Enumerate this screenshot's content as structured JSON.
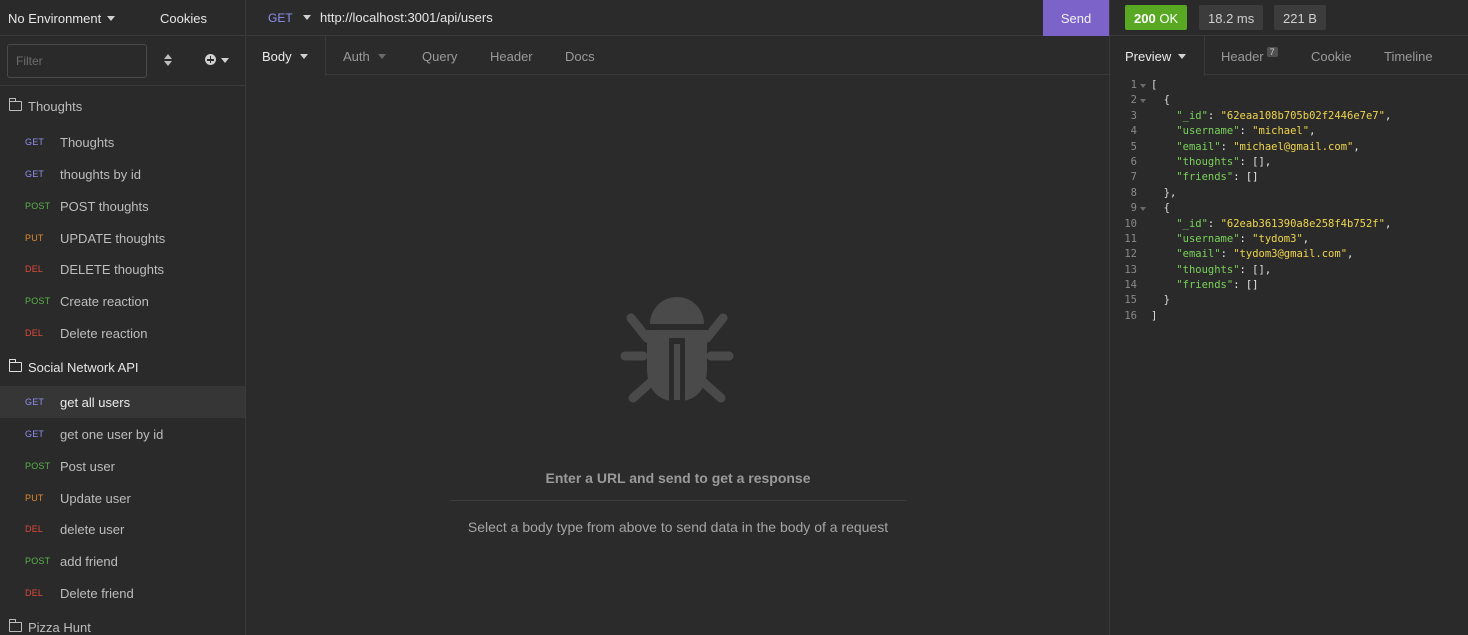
{
  "sidebar": {
    "environment": "No Environment",
    "cookies_label": "Cookies",
    "filter_placeholder": "Filter",
    "folders": [
      {
        "name": "Thoughts"
      },
      {
        "name": "Social Network API"
      },
      {
        "name": "Pizza Hunt"
      }
    ],
    "requests": [
      {
        "method": "GET",
        "label": "Thoughts"
      },
      {
        "method": "GET",
        "label": "thoughts by id"
      },
      {
        "method": "POST",
        "label": "POST thoughts"
      },
      {
        "method": "PUT",
        "label": "UPDATE thoughts"
      },
      {
        "method": "DEL",
        "label": "DELETE thoughts"
      },
      {
        "method": "POST",
        "label": "Create reaction"
      },
      {
        "method": "DEL",
        "label": "Delete reaction"
      },
      {
        "method": "GET",
        "label": "get all users"
      },
      {
        "method": "GET",
        "label": "get one user by id"
      },
      {
        "method": "POST",
        "label": "Post user"
      },
      {
        "method": "PUT",
        "label": "Update user"
      },
      {
        "method": "DEL",
        "label": "delete user"
      },
      {
        "method": "POST",
        "label": "add friend"
      },
      {
        "method": "DEL",
        "label": "Delete friend"
      }
    ]
  },
  "request": {
    "method": "GET",
    "url": "http://localhost:3001/api/users",
    "send_label": "Send",
    "tabs": [
      "Body",
      "Auth",
      "Query",
      "Header",
      "Docs"
    ],
    "empty_title": "Enter a URL and send to get a response",
    "empty_subtitle": "Select a body type from above to send data in the body of a request"
  },
  "response": {
    "status_code": "200",
    "status_text": "OK",
    "time": "18.2 ms",
    "size": "221 B",
    "tabs": [
      "Preview",
      "Header",
      "Cookie",
      "Timeline"
    ],
    "header_count": "7",
    "line_numbers": [
      "1",
      "2",
      "3",
      "4",
      "5",
      "6",
      "7",
      "8",
      "9",
      "10",
      "11",
      "12",
      "13",
      "14",
      "15",
      "16"
    ],
    "users": [
      {
        "_id": "62eaa108b705b02f2446e7e7",
        "username": "michael",
        "email": "michael@gmail.com",
        "thoughts": "[]",
        "friends": "[]"
      },
      {
        "_id": "62eab361390a8e258f4b752f",
        "username": "tydom3",
        "email": "tydom3@gmail.com",
        "thoughts": "[]",
        "friends": "[]"
      }
    ]
  },
  "colors": {
    "get": "#8f8ff0",
    "post": "#59b24a",
    "put": "#e08a2e",
    "del": "#e0493a",
    "send": "#7b63c9",
    "status_ok": "#58a824",
    "json_key": "#79d25a",
    "json_string": "#f0d64c"
  }
}
